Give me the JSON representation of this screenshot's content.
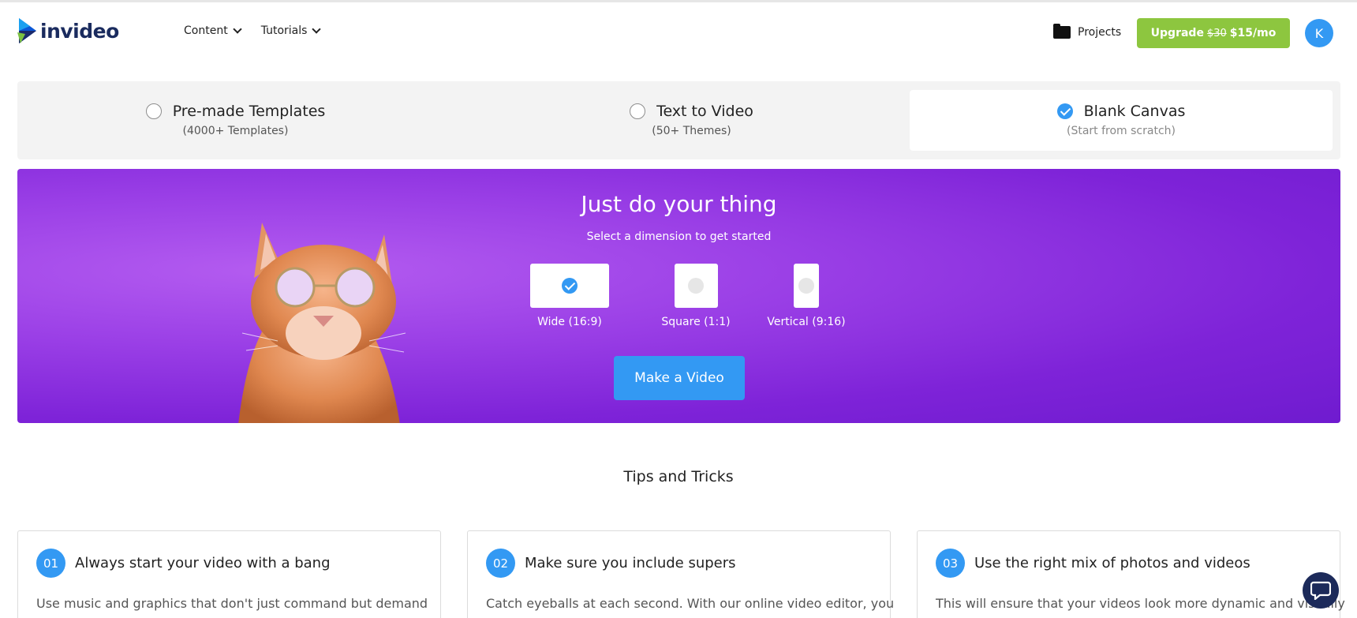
{
  "brand": {
    "name": "invideo"
  },
  "nav": {
    "items": [
      {
        "label": "Content"
      },
      {
        "label": "Tutorials"
      }
    ]
  },
  "header": {
    "projects_label": "Projects",
    "upgrade": {
      "label": "Upgrade",
      "old_price": "$30",
      "new_price": "$15/mo"
    },
    "avatar_initial": "K"
  },
  "modes": [
    {
      "title": "Pre-made Templates",
      "subtitle": "(4000+ Templates)",
      "selected": false
    },
    {
      "title": "Text to Video",
      "subtitle": "(50+ Themes)",
      "selected": false
    },
    {
      "title": "Blank Canvas",
      "subtitle": "(Start from scratch)",
      "selected": true
    }
  ],
  "hero": {
    "title": "Just do your thing",
    "subtitle": "Select a dimension to get started",
    "dimensions": [
      {
        "label": "Wide (16:9)",
        "selected": true
      },
      {
        "label": "Square (1:1)",
        "selected": false
      },
      {
        "label": "Vertical (9:16)",
        "selected": false
      }
    ],
    "cta": "Make a Video"
  },
  "tips": {
    "title": "Tips and Tricks",
    "cards": [
      {
        "number": "01",
        "title": "Always start your video with a bang",
        "body": "Use music and graphics that don't just command but demand"
      },
      {
        "number": "02",
        "title": "Make sure you include supers",
        "body": "Catch eyeballs at each second. With our online video editor, you"
      },
      {
        "number": "03",
        "title": "Use the right mix of photos and videos",
        "body": "This will ensure that your videos look more dynamic and visually"
      }
    ]
  },
  "colors": {
    "accent": "#3399f3",
    "upgrade": "#8dc63f",
    "hero": "#8a2fe0",
    "chat": "#1c2a5a"
  },
  "icons": {
    "logo": "play-triangle-logo-icon",
    "chevron": "chevron-down-icon",
    "folder": "folder-icon",
    "check": "check-icon",
    "chat": "chat-bubble-icon"
  }
}
